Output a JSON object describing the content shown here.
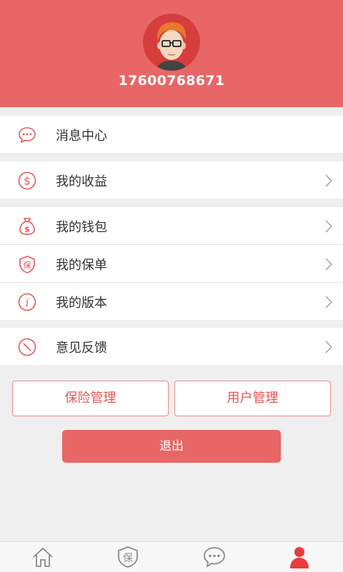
{
  "profile": {
    "phone": "17600768671",
    "avatar_icon": "user-avatar-icon"
  },
  "menu": {
    "message_center": {
      "label": "消息中心",
      "icon": "chat-bubble-icon"
    },
    "earnings": {
      "label": "我的收益",
      "icon": "dollar-coin-icon"
    },
    "wallet": {
      "label": "我的钱包",
      "icon": "money-bag-icon"
    },
    "policy": {
      "label": "我的保单",
      "icon": "shield-bao-icon"
    },
    "version": {
      "label": "我的版本",
      "icon": "info-icon"
    },
    "feedback": {
      "label": "意见反馈",
      "icon": "compass-icon"
    }
  },
  "buttons": {
    "insurance_manage": "保险管理",
    "user_manage": "用户管理",
    "logout": "退出"
  },
  "tabs": {
    "home": {
      "icon": "home-icon"
    },
    "policy": {
      "icon": "bao-tab-icon",
      "glyph": "保"
    },
    "messages": {
      "icon": "chat-tab-icon"
    },
    "profile": {
      "icon": "person-tab-icon",
      "active": true
    }
  },
  "colors": {
    "accent": "#e86666",
    "icon_red": "#e25858",
    "tab_inactive": "#8a8a8a",
    "tab_active": "#e83b3b"
  }
}
